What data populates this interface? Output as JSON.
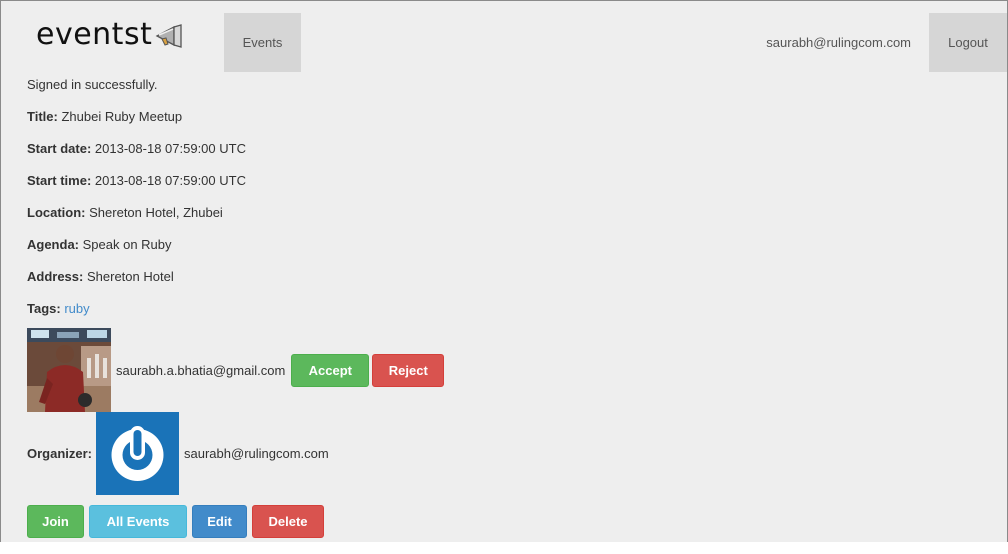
{
  "navbar": {
    "brand": "eventst",
    "brand_icon": "megaphone-icon",
    "events_label": "Events",
    "user_email": "saurabh@rulingcom.com",
    "logout_label": "Logout"
  },
  "flash": {
    "notice": "Signed in successfully."
  },
  "event": {
    "title_label": "Title:",
    "title": "Zhubei Ruby Meetup",
    "start_date_label": "Start date:",
    "start_date": "2013-08-18 07:59:00 UTC",
    "start_time_label": "Start time:",
    "start_time": "2013-08-18 07:59:00 UTC",
    "location_label": "Location:",
    "location": "Shereton Hotel, Zhubei",
    "agenda_label": "Agenda:",
    "agenda": "Speak on Ruby",
    "address_label": "Address:",
    "address": "Shereton Hotel",
    "tags_label": "Tags:",
    "tags": [
      "ruby"
    ]
  },
  "attendee": {
    "email": "saurabh.a.bhatia@gmail.com",
    "accept_label": "Accept",
    "reject_label": "Reject"
  },
  "organizer": {
    "label": "Organizer:",
    "email": "saurabh@rulingcom.com",
    "avatar_icon": "power-icon"
  },
  "actions": {
    "join_label": "Join",
    "all_events_label": "All Events",
    "edit_label": "Edit",
    "delete_label": "Delete"
  },
  "colors": {
    "page_bg": "#eeeeee",
    "nav_tab_bg": "#d6d6d6",
    "success": "#5cb85c",
    "danger": "#d9534f",
    "info": "#5bc0de",
    "primary": "#428bca",
    "link": "#428bca",
    "organizer_avatar_bg": "#1a73b8"
  }
}
